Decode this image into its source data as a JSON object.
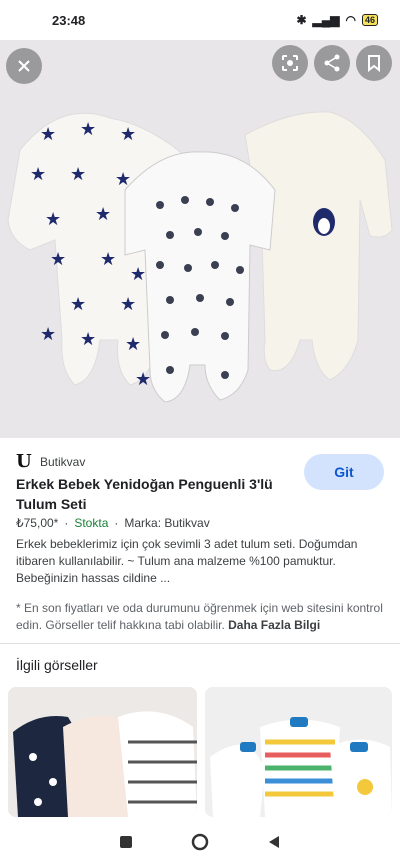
{
  "status": {
    "time": "23:48",
    "battery": "46"
  },
  "hero": {
    "close_icon": "close-icon",
    "lens_icon": "lens-icon",
    "share_icon": "share-icon",
    "bookmark_icon": "bookmark-icon",
    "colors": {
      "background": "#e9e6ea",
      "navy": "#1f2a6d"
    }
  },
  "result": {
    "source_logo": "U",
    "source_name": "Butikvav",
    "go_label": "Git",
    "title": "Erkek Bebek Yenidoğan Penguenli 3'lü Tulum Seti",
    "price": "₺75,00*",
    "stock": "Stokta",
    "brand": "Marka: Butikvav",
    "description": "Erkek bebeklerimiz için çok sevimli 3 adet tulum seti. Doğumdan itibaren kullanılabilir. ~ Tulum ana malzeme %100 pamuktur. Bebeğinizin hassas cildine ...",
    "notice": "* En son fiyatları ve oda durumunu öğrenmek için web sitesini kontrol edin. Görseller telif hakkına tabi olabilir.",
    "notice_link": "Daha Fazla Bilgi"
  },
  "related": {
    "title": "İlgili görseller"
  },
  "accent": "#0b57d0",
  "accent_bg": "#d3e3fd"
}
